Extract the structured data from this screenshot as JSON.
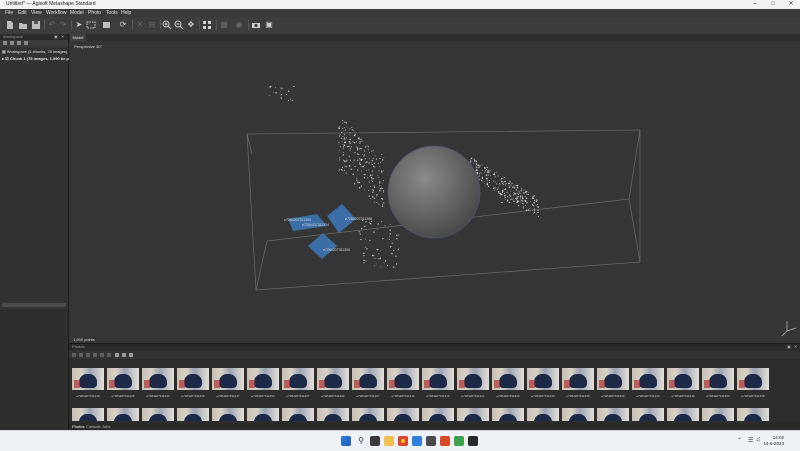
{
  "window": {
    "title": "Untitled* — Agisoft Metashape Standard"
  },
  "menu": [
    "File",
    "Edit",
    "View",
    "Workflow",
    "Model",
    "Photo",
    "Tools",
    "Help"
  ],
  "workspace": {
    "header": "Workspace",
    "root": "Workspace (1 chunks, 75 images)",
    "chunk": "Chunk 1 (75 images, 1,990 tie points)"
  },
  "model": {
    "tab": "Model",
    "projection": "Perspective 30°",
    "points_label": "1,990 points",
    "camera_labels": [
      "e7284207311369",
      "e7284207311374",
      "e7284207311306",
      "e7284207311306"
    ]
  },
  "photos": {
    "header": "Photos",
    "captions": [
      "e7284207311219",
      "e7284207311226",
      "e7284207311234",
      "e7284207311239",
      "e7284207311247",
      "e7284207311252",
      "e7284207311257",
      "e7284207311302",
      "e7284207311307",
      "e7284207311310",
      "e7284207311316",
      "e7284207311321",
      "e7284207311326",
      "e7284207311330",
      "e7284207311335",
      "e7284207311340",
      "e7284207311344",
      "e7284207311349",
      "e7284207311353",
      "e7284207311358"
    ],
    "bottom_tabs": [
      "Photos",
      "Console",
      "Jobs"
    ]
  },
  "taskbar": {
    "time": "14:02",
    "date": "14-6-2023"
  },
  "colors": {
    "accent": "#3a6ea5",
    "viewport_bg": "#353535"
  },
  "icons": [
    "new-icon",
    "open-icon",
    "save-icon",
    "undo-icon",
    "redo-icon",
    "select-icon",
    "region-icon",
    "rotate-icon",
    "delete-icon",
    "crop-icon",
    "zoom-in-icon",
    "zoom-out-icon",
    "move-icon",
    "fit-icon",
    "grid-icon",
    "camera-icon",
    "search-icon",
    "windows-icon"
  ]
}
